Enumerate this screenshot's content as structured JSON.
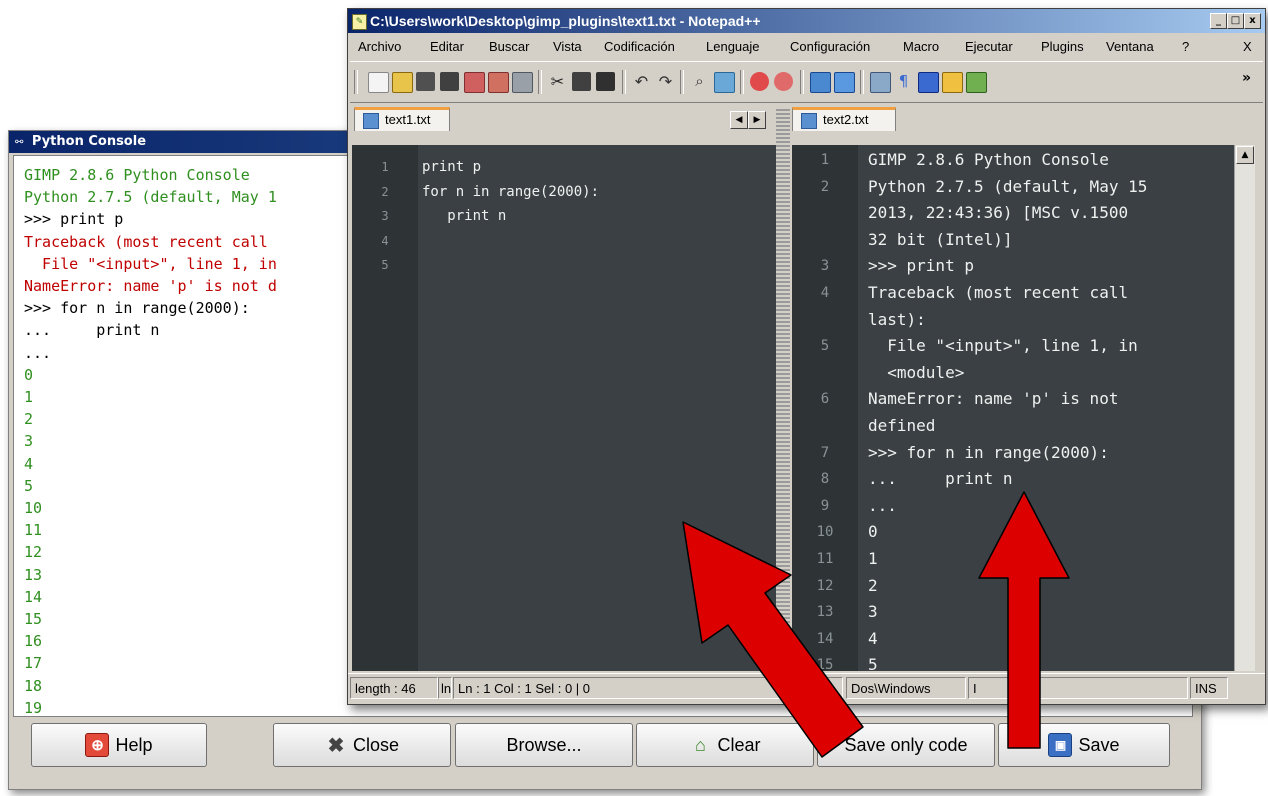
{
  "python_console": {
    "title": "Python Console",
    "output_lines": [
      {
        "text": "GIMP 2.8.6 Python Console",
        "color": "green"
      },
      {
        "text": "Python 2.7.5 (default, May 1",
        "color": "green"
      },
      {
        "text": ">>> print p",
        "color": "black"
      },
      {
        "text": "Traceback (most recent call",
        "color": "red"
      },
      {
        "text": "  File \"<input>\", line 1, in",
        "color": "red"
      },
      {
        "text": "NameError: name 'p' is not d",
        "color": "red"
      },
      {
        "text": ">>> for n in range(2000):",
        "color": "black"
      },
      {
        "text": "...     print n",
        "color": "black"
      },
      {
        "text": "...",
        "color": "black"
      },
      {
        "text": "0",
        "color": "green"
      },
      {
        "text": "1",
        "color": "green"
      },
      {
        "text": "2",
        "color": "green"
      },
      {
        "text": "3",
        "color": "green"
      },
      {
        "text": "4",
        "color": "green"
      },
      {
        "text": "5",
        "color": "green"
      },
      {
        "text": "10",
        "color": "green"
      },
      {
        "text": "11",
        "color": "green"
      },
      {
        "text": "12",
        "color": "green"
      },
      {
        "text": "13",
        "color": "green"
      },
      {
        "text": "14",
        "color": "green"
      },
      {
        "text": "15",
        "color": "green"
      },
      {
        "text": "16",
        "color": "green"
      },
      {
        "text": "17",
        "color": "green"
      },
      {
        "text": "18",
        "color": "green"
      },
      {
        "text": "19",
        "color": "green"
      }
    ],
    "buttons": {
      "help": "Help",
      "close": "Close",
      "browse": "Browse...",
      "clear": "Clear",
      "save_only_code": "Save only code",
      "save": "Save"
    }
  },
  "notepad": {
    "title": "C:\\Users\\work\\Desktop\\gimp_plugins\\text1.txt - Notepad++",
    "window_buttons": {
      "minimize": "_",
      "maximize": "□",
      "close": "x"
    },
    "menu": [
      "Archivo",
      "Editar",
      "Buscar",
      "Vista",
      "Codificación",
      "Lenguaje",
      "Configuración",
      "Macro",
      "Ejecutar",
      "Plugins",
      "Ventana",
      "?"
    ],
    "menu_close": "X",
    "toolbar_more": "»",
    "left_tab": "text1.txt",
    "right_tab": "text2.txt",
    "left_editor": {
      "line_numbers": [
        "1",
        "2",
        "3",
        "4",
        "5"
      ],
      "lines": [
        "print p",
        "for n in range(2000):",
        "   print n",
        "",
        ""
      ]
    },
    "right_editor": {
      "lines": [
        {
          "num": "1",
          "text": "GIMP 2.8.6 Python Console"
        },
        {
          "num": "2",
          "text": "Python 2.7.5 (default, May 15"
        },
        {
          "num": "",
          "text": "2013, 22:43:36) [MSC v.1500"
        },
        {
          "num": "",
          "text": "32 bit (Intel)]"
        },
        {
          "num": "3",
          "text": ">>> print p"
        },
        {
          "num": "4",
          "text": "Traceback (most recent call"
        },
        {
          "num": "",
          "text": "last):"
        },
        {
          "num": "5",
          "text": "  File \"<input>\", line 1, in"
        },
        {
          "num": "",
          "text": "  <module>"
        },
        {
          "num": "6",
          "text": "NameError: name 'p' is not"
        },
        {
          "num": "",
          "text": "defined"
        },
        {
          "num": "7",
          "text": ">>> for n in range(2000):"
        },
        {
          "num": "8",
          "text": "...     print n"
        },
        {
          "num": "9",
          "text": "..."
        },
        {
          "num": "10",
          "text": "0"
        },
        {
          "num": "11",
          "text": "1"
        },
        {
          "num": "12",
          "text": "2"
        },
        {
          "num": "13",
          "text": "3"
        },
        {
          "num": "14",
          "text": "4"
        },
        {
          "num": "15",
          "text": "5"
        }
      ]
    },
    "status": {
      "length": "length : 46",
      "ln_label": "ln",
      "position": "Ln : 1    Col : 1    Sel : 0 | 0",
      "eol": "Dos\\Windows",
      "encoding": "I",
      "ins": "INS"
    }
  },
  "colors": {
    "editor_bg": "#3a4043",
    "gutter_bg": "#2e3436",
    "console_green": "#2f8f1f",
    "console_red": "#c00000",
    "arrow_red": "#dd0000",
    "titlebar": "#0a246a"
  },
  "icons": [
    "python-icon",
    "notepadpp-icon",
    "help-icon",
    "close-icon",
    "clear-icon",
    "save-icon",
    "file-icon",
    "arrow-left-icon",
    "arrow-right-icon",
    "scroll-up-icon"
  ]
}
